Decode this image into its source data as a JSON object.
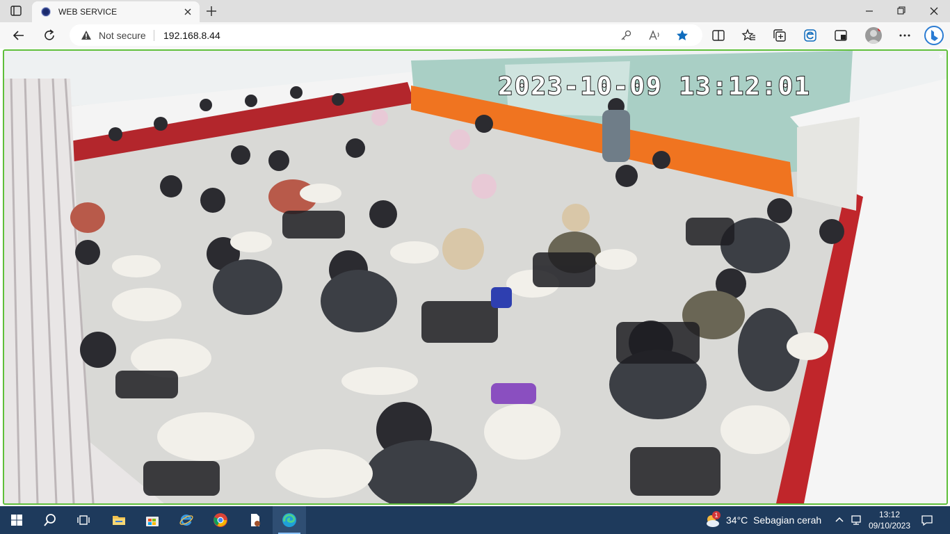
{
  "browser": {
    "tab": {
      "title": "WEB SERVICE",
      "favicon": "camera-service-icon"
    },
    "address": {
      "security_label": "Not secure",
      "url": "192.168.8.44"
    },
    "toolbar_icons": [
      "split-screen-icon",
      "favorites-icon",
      "collections-icon",
      "edge-feature-icon",
      "performance-icon",
      "profile-avatar",
      "more-icon",
      "bing-copilot-icon"
    ],
    "accent": "#0f6cbd"
  },
  "camera": {
    "timestamp": "2023-10-09 13:12:01",
    "border_color": "#5fbf3a",
    "close_glyph": "×"
  },
  "taskbar": {
    "apps": [
      "windows-start-icon",
      "search-icon",
      "task-view-icon",
      "file-explorer-icon",
      "microsoft-store-icon",
      "internet-explorer-icon",
      "chrome-icon",
      "document-app-icon",
      "edge-icon"
    ],
    "weather": {
      "badge": "1",
      "temp": "34°C",
      "condition": "Sebagian cerah"
    },
    "clock": {
      "time": "13:12",
      "date": "09/10/2023"
    },
    "color": "#1e3a5c"
  }
}
